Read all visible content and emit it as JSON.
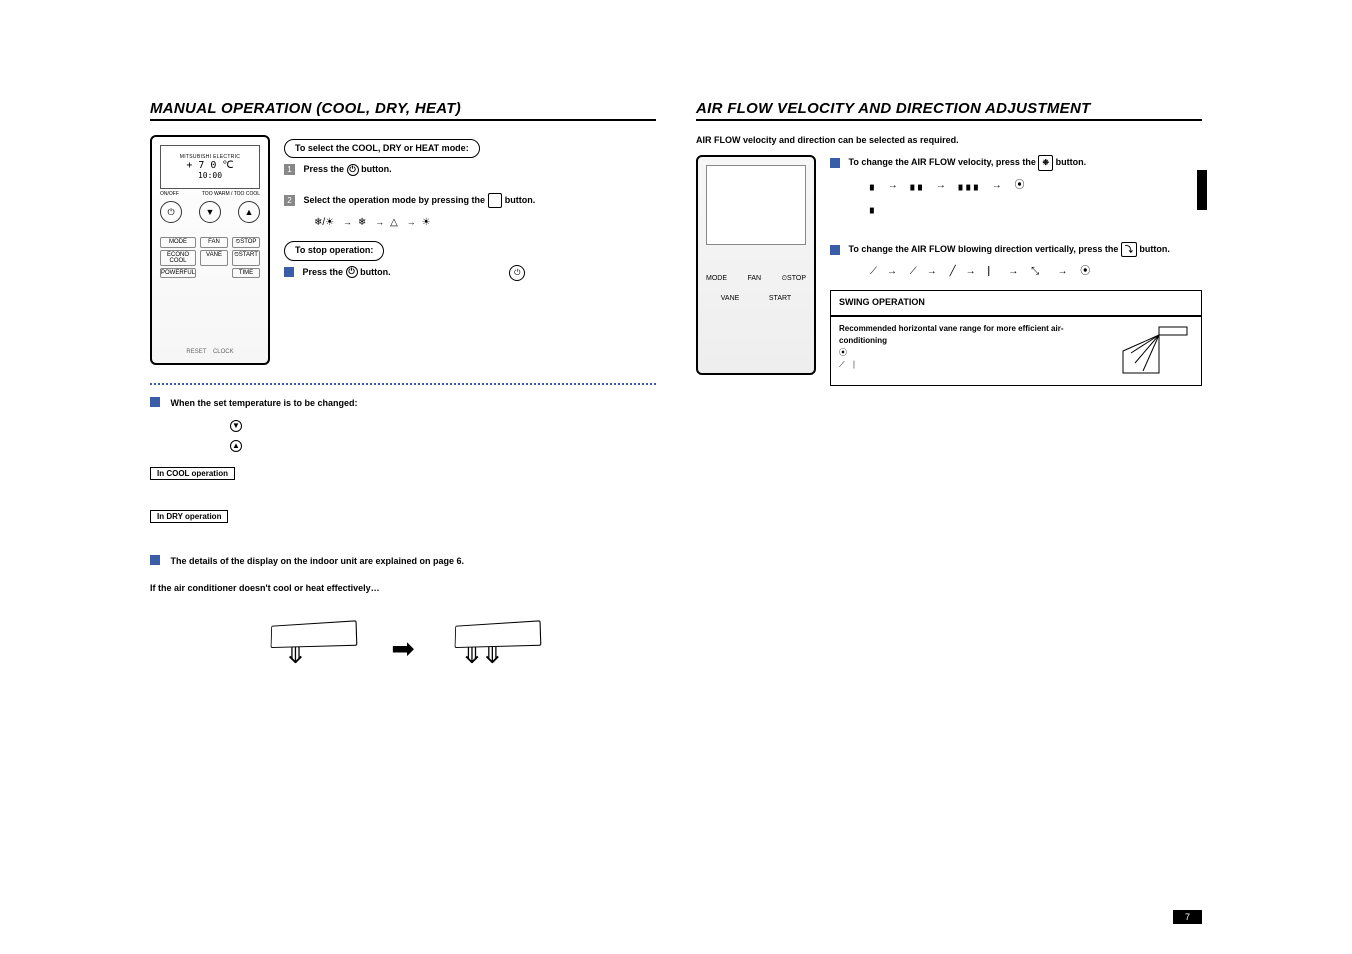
{
  "page_number": "7",
  "left": {
    "title": "MANUAL OPERATION (COOL, DRY, HEAT)",
    "remote": {
      "brand": "MITSUBISHI ELECTRIC",
      "temp_icons": "❄ ☀",
      "temp": "+ 7 0 ℃",
      "clock": "10:00",
      "onoff": "ON/OFF",
      "too_cool": "TOO WARM / TOO COOL",
      "btn_down": "▼",
      "btn_up": "▲",
      "btn_power": "⏻",
      "labels": {
        "mode": "MODE",
        "fan": "FAN",
        "stop": "⏲STOP",
        "econo": "ECONO COOL",
        "vane": "VANE",
        "start": "⏲START",
        "powerful": "POWERFUL",
        "time": "TIME",
        "reset": "RESET",
        "clocklbl": "CLOCK"
      }
    },
    "select_pill": "To select the COOL, DRY or HEAT mode:",
    "step1": "Press the",
    "step1_after": "button.",
    "step2": "Select the operation mode by pressing the",
    "step2_after": "button.",
    "mode_icons": {
      "i1": "❄/☀",
      "i2": "❄",
      "i3": "△",
      "i4": "☀"
    },
    "stop_pill": "To stop operation:",
    "stop_press": "Press the",
    "stop_after": "button.",
    "temp_change_head": "When the set temperature is to be changed:",
    "box_cool": "In COOL operation",
    "box_dry": "In DRY operation",
    "indoor_display": "The details of the display on the indoor unit are explained on page 6.",
    "if_note": "If the air conditioner doesn't cool or heat effectively…"
  },
  "right": {
    "title": "AIR FLOW VELOCITY AND DIRECTION ADJUSTMENT",
    "intro": "AIR FLOW velocity and direction can be selected as required.",
    "velocity_head_a": "To change the AIR FLOW velocity, press the",
    "velocity_head_b": "button.",
    "velocity_btn": "❉",
    "velocity_levels": {
      "l1": "▖",
      "l2": "▖▖",
      "l3": "▖▖▖",
      "auto": "⦿"
    },
    "direction_head_a": "To change the AIR FLOW blowing direction vertically, press the",
    "direction_head_b": "button.",
    "direction_btn": "⤵",
    "swing_title": "SWING OPERATION",
    "rec_text": "Recommended horizontal vane range for more efficient air-conditioning",
    "remote2": {
      "mode": "MODE",
      "fan": "FAN",
      "stop": "⏲STOP",
      "vane": "VANE",
      "start": "START"
    }
  }
}
